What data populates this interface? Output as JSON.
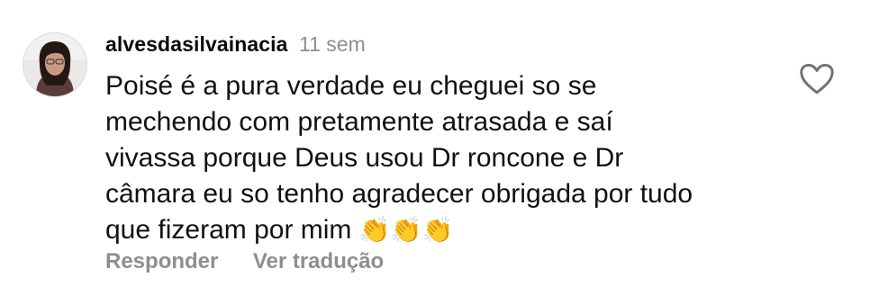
{
  "comment": {
    "username": "alvesdasilvainacia",
    "time": "11 sem",
    "text_lines": [
      "Poisé é a pura verdade eu cheguei so se",
      "mechendo com pretamente atrasada e saí",
      "vivassa porque Deus usou Dr roncone e Dr",
      "câmara eu so tenho agradecer obrigada por tudo",
      "que fizeram por mim"
    ],
    "emojis": "👏👏👏",
    "reply_label": "Responder",
    "translate_label": "Ver tradução",
    "icons": {
      "avatar": "user-avatar",
      "like": "heart-icon",
      "emoji": "clapping-hands"
    }
  },
  "colors": {
    "muted": "#8e8e8e",
    "text": "#111111",
    "icon": "#7a7a7a"
  }
}
